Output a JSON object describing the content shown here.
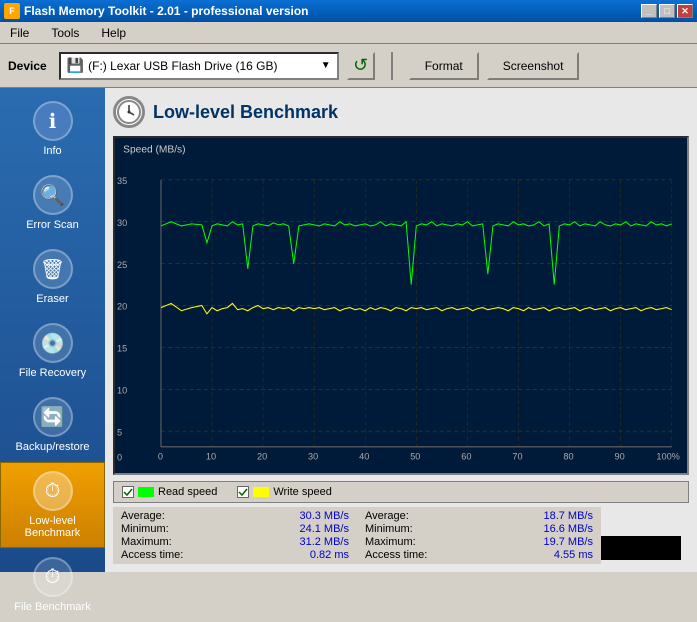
{
  "titleBar": {
    "title": "Flash Memory Toolkit - 2.01 - professional version",
    "icon": "💾",
    "buttons": [
      "_",
      "□",
      "✕"
    ]
  },
  "menuBar": {
    "items": [
      "File",
      "Tools",
      "Help"
    ]
  },
  "toolbar": {
    "deviceLabel": "Device",
    "deviceIcon": "💾",
    "deviceName": "(F:) Lexar  USB Flash Drive (16 GB)",
    "refreshIcon": "↺",
    "formatLabel": "Format",
    "screenshotLabel": "Screenshot"
  },
  "sidebar": {
    "items": [
      {
        "id": "info",
        "label": "Info",
        "icon": "ℹ",
        "active": false
      },
      {
        "id": "error-scan",
        "label": "Error Scan",
        "icon": "🔍",
        "active": false
      },
      {
        "id": "eraser",
        "label": "Eraser",
        "icon": "🗑",
        "active": false
      },
      {
        "id": "file-recovery",
        "label": "File Recovery",
        "icon": "💿",
        "active": false
      },
      {
        "id": "backup-restore",
        "label": "Backup/restore",
        "icon": "🔄",
        "active": false
      },
      {
        "id": "low-level-benchmark",
        "label": "Low-level Benchmark",
        "icon": "⏱",
        "active": true
      },
      {
        "id": "file-benchmark",
        "label": "File Benchmark",
        "icon": "⏱",
        "active": false
      }
    ]
  },
  "content": {
    "title": "Low-level Benchmark",
    "chartYLabel": "Speed (MB/s)",
    "yAxisLabels": [
      "35",
      "30",
      "25",
      "20",
      "15",
      "10",
      "5",
      "0"
    ],
    "xAxisLabels": [
      "0",
      "10",
      "20",
      "30",
      "40",
      "50",
      "60",
      "70",
      "80",
      "90",
      "100%"
    ]
  },
  "legend": {
    "readLabel": "Read speed",
    "writeLabel": "Write speed",
    "readColor": "#00ff00",
    "writeColor": "#ffff00"
  },
  "stats": {
    "read": {
      "averageLabel": "Average:",
      "averageValue": "30.3 MB/s",
      "minimumLabel": "Minimum:",
      "minimumValue": "24.1 MB/s",
      "maximumLabel": "Maximum:",
      "maximumValue": "31.2 MB/s",
      "accessTimeLabel": "Access time:",
      "accessTimeValue": "0.82 ms"
    },
    "write": {
      "averageLabel": "Average:",
      "averageValue": "18.7 MB/s",
      "minimumLabel": "Minimum:",
      "minimumValue": "16.6 MB/s",
      "maximumLabel": "Maximum:",
      "maximumValue": "19.7 MB/s",
      "accessTimeLabel": "Access time:",
      "accessTimeValue": "4.55 ms"
    }
  }
}
